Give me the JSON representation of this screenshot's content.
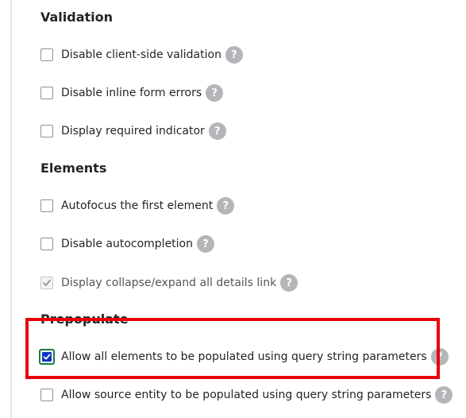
{
  "sections": {
    "validation": {
      "title": "Validation",
      "items": [
        {
          "label": "Disable client-side validation",
          "checked": false
        },
        {
          "label": "Disable inline form errors",
          "checked": false
        },
        {
          "label": "Display required indicator",
          "checked": false
        }
      ]
    },
    "elements": {
      "title": "Elements",
      "items": [
        {
          "label": "Autofocus the first element",
          "checked": false
        },
        {
          "label": "Disable autocompletion",
          "checked": false
        },
        {
          "label": "Display collapse/expand all details link",
          "checked": true,
          "disabled": true
        }
      ]
    },
    "prepopulate": {
      "title": "Prepopulate",
      "items": [
        {
          "label": "Allow all elements to be populated using query string parameters",
          "checked": true
        },
        {
          "label": "Allow source entity to be populated using query string parameters",
          "checked": false
        }
      ]
    }
  },
  "help_glyph": "?",
  "colors": {
    "highlight_border": "#e8000b",
    "checkbox_checked_fill": "#0f33c3",
    "checkbox_focus_ring": "#1a7a3f",
    "help_badge": "#b4b5b9"
  }
}
